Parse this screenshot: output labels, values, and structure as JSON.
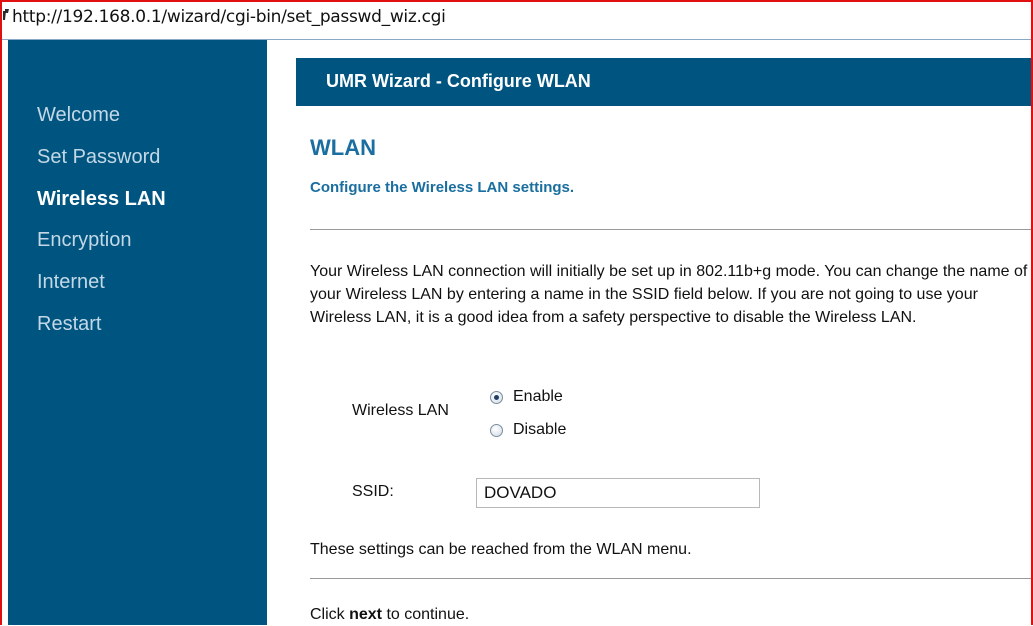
{
  "browser": {
    "url": "http://192.168.0.1/wizard/cgi-bin/set_passwd_wiz.cgi"
  },
  "sidebar": {
    "items": [
      {
        "label": "Welcome",
        "active": false
      },
      {
        "label": "Set Password",
        "active": false
      },
      {
        "label": "Wireless LAN",
        "active": true
      },
      {
        "label": "Encryption",
        "active": false
      },
      {
        "label": "Internet",
        "active": false
      },
      {
        "label": "Restart",
        "active": false
      }
    ]
  },
  "header": {
    "title": "UMR Wizard - Configure WLAN"
  },
  "main": {
    "heading": "WLAN",
    "subheading": "Configure the Wireless LAN settings.",
    "intro": "Your Wireless LAN connection will initially be set up in 802.11b+g mode. You can change the name of your Wireless LAN by entering a name in the SSID field below. If you are not going to use your Wireless LAN, it is a good idea from a safety perspective to disable the Wireless LAN.",
    "wireless_lan": {
      "label": "Wireless LAN",
      "options": [
        {
          "label": "Enable",
          "checked": true
        },
        {
          "label": "Disable",
          "checked": false
        }
      ]
    },
    "ssid": {
      "label": "SSID:",
      "value": "DOVADO"
    },
    "note": "These settings can be reached from the WLAN menu.",
    "continue": {
      "prefix": "Click ",
      "keyword": "next",
      "suffix": " to continue."
    }
  },
  "colors": {
    "accent_navy": "#005580",
    "heading_blue": "#1a6ea0",
    "frame_red": "#e01010"
  }
}
